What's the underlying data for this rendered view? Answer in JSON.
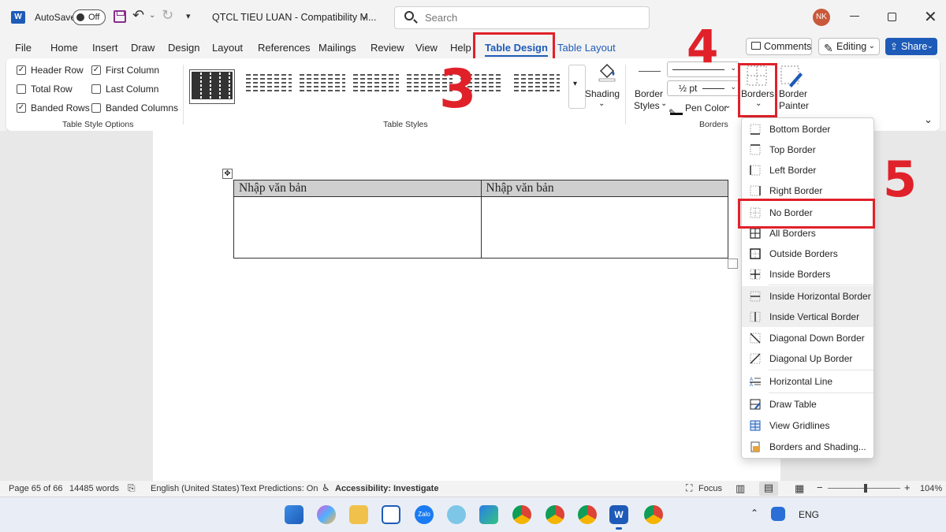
{
  "titlebar": {
    "autosave_label": "AutoSave",
    "autosave_state": "Off",
    "doc_title": "QTCL TIEU LUAN  -  Compatibility M...",
    "search_placeholder": "Search",
    "user_initials": "NK"
  },
  "tabs": [
    "File",
    "Home",
    "Insert",
    "Draw",
    "Design",
    "Layout",
    "References",
    "Mailings",
    "Review",
    "View",
    "Help",
    "Table Design",
    "Table Layout"
  ],
  "active_tab": "Table Design",
  "header_buttons": {
    "comments": "Comments",
    "editing": "Editing",
    "share": "Share"
  },
  "ribbon": {
    "style_options": {
      "header_row": "Header Row",
      "first_column": "First Column",
      "total_row": "Total Row",
      "last_column": "Last Column",
      "banded_rows": "Banded Rows",
      "banded_columns": "Banded Columns",
      "group_label": "Table Style Options"
    },
    "table_styles_label": "Table Styles",
    "shading": "Shading",
    "border_styles": "Border\nStyles",
    "border_styles_l1": "Border",
    "border_styles_l2": "Styles",
    "pen_weight": "½ pt",
    "pen_color": "Pen Color",
    "borders": "Borders",
    "border_painter_l1": "Border",
    "border_painter_l2": "Painter",
    "borders_group_label": "Borders"
  },
  "annotations": {
    "step3": "3",
    "step4": "4",
    "step5": "5",
    "color": "#e0212a"
  },
  "document": {
    "table": {
      "header": [
        "Nhập văn bản",
        "Nhập văn bản"
      ],
      "body": [
        [
          "",
          ""
        ]
      ]
    }
  },
  "borders_menu": [
    "Bottom Border",
    "Top Border",
    "Left Border",
    "Right Border",
    "No Border",
    "All Borders",
    "Outside Borders",
    "Inside Borders",
    "Inside Horizontal Border",
    "Inside Vertical Border",
    "Diagonal Down Border",
    "Diagonal Up Border",
    "Horizontal Line",
    "Draw Table",
    "View Gridlines",
    "Borders and Shading..."
  ],
  "statusbar": {
    "page": "Page 65 of 66",
    "words": "14485 words",
    "language": "English (United States)",
    "predictions": "Text Predictions: On",
    "accessibility": "Accessibility: Investigate",
    "focus": "Focus",
    "zoom": "104%"
  },
  "taskbar": {
    "language": "ENG"
  },
  "colors": {
    "accent": "#1e5bb8",
    "annotation_red": "#e0212a",
    "header_fill": "#cfcfcf"
  }
}
